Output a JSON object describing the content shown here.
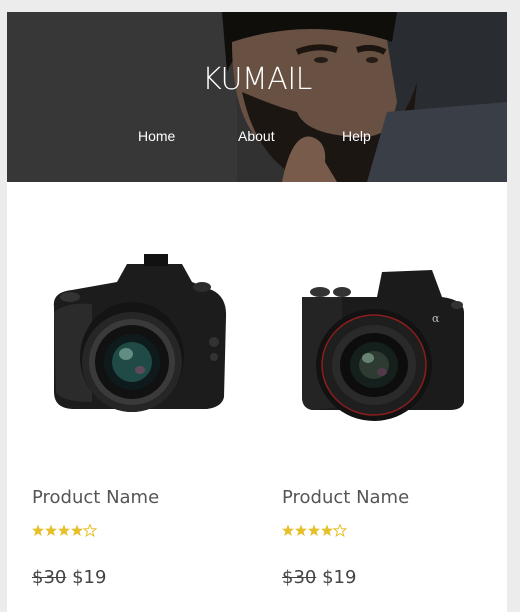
{
  "header": {
    "brand": "KUMAIL",
    "nav": [
      {
        "label": "Home"
      },
      {
        "label": "About"
      },
      {
        "label": "Help"
      }
    ]
  },
  "products": [
    {
      "name": "Product Name",
      "rating": 4,
      "rating_max": 5,
      "old_price": "$30",
      "price": "$19",
      "image_icon": "dslr-camera-icon"
    },
    {
      "name": "Product Name",
      "rating": 4,
      "rating_max": 5,
      "old_price": "$30",
      "price": "$19",
      "image_icon": "mirrorless-camera-icon"
    }
  ],
  "colors": {
    "star": "#e6c02a",
    "text": "#555555",
    "page_bg": "#ececec"
  }
}
